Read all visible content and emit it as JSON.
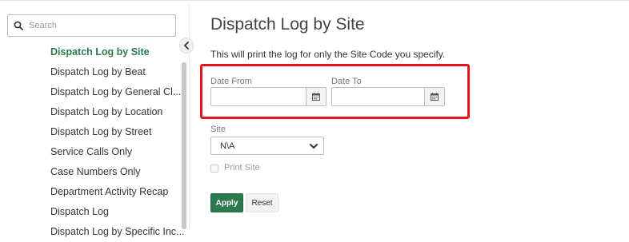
{
  "search": {
    "placeholder": "Search"
  },
  "sidebar": {
    "items": [
      {
        "label": "Dispatch Log by Site",
        "active": true
      },
      {
        "label": "Dispatch Log by Beat"
      },
      {
        "label": "Dispatch Log by General Cl..."
      },
      {
        "label": "Dispatch Log by Location"
      },
      {
        "label": "Dispatch Log by Street"
      },
      {
        "label": "Service Calls Only"
      },
      {
        "label": "Case Numbers Only"
      },
      {
        "label": "Department Activity Recap"
      },
      {
        "label": "Dispatch Log"
      },
      {
        "label": "Dispatch Log by Specific Inc..."
      }
    ]
  },
  "main": {
    "title": "Dispatch Log by Site",
    "description": "This will print the log for only the Site Code you specify.",
    "date_from": {
      "label": "Date From",
      "value": ""
    },
    "date_to": {
      "label": "Date To",
      "value": ""
    },
    "site": {
      "label": "Site",
      "selected": "N\\A"
    },
    "print_site": {
      "label": "Print Site",
      "checked": false
    },
    "apply_label": "Apply",
    "reset_label": "Reset"
  },
  "colors": {
    "accent": "#2e7a4b",
    "highlight": "#e8141b"
  }
}
